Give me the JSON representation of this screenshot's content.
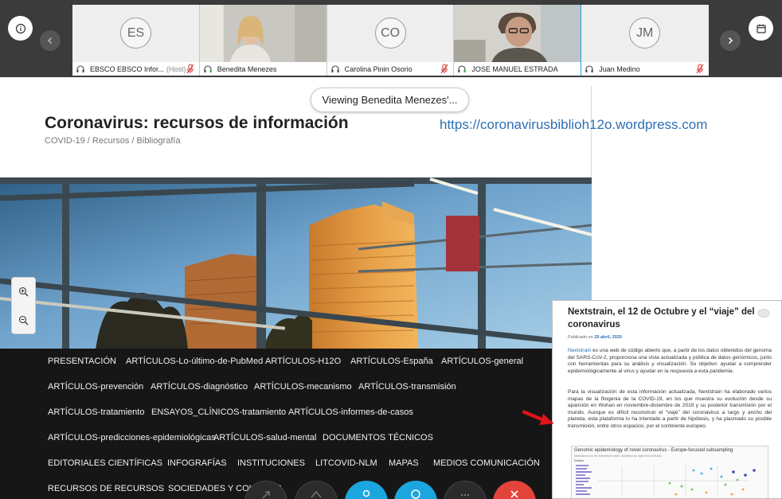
{
  "participants": [
    {
      "initials": "ES",
      "name": "EBSCO EBSCO Infor...",
      "host_tag": "(Host)",
      "video": false,
      "muted": true
    },
    {
      "initials": "",
      "name": "Benedita Menezes",
      "host_tag": "",
      "video": true,
      "muted": false
    },
    {
      "initials": "CO",
      "name": "Carolina Pinin Osorio",
      "host_tag": "",
      "video": false,
      "muted": true
    },
    {
      "initials": "",
      "name": "JOSE MANUEL ESTRADA",
      "host_tag": "",
      "video": true,
      "muted": false
    },
    {
      "initials": "JM",
      "name": "Juan Medino",
      "host_tag": "",
      "video": false,
      "muted": true
    }
  ],
  "viewing_banner": "Viewing Benedita Menezes'...",
  "site": {
    "title": "Coronavirus: recursos de información",
    "breadcrumb": "COVID-19 / Recursos / Bibliografía",
    "url": "https://coronavirusbiblioh12o.wordpress.com"
  },
  "menu": [
    "PRESENTACIÓN",
    "ARTÍCULOS-Lo-último-de-PubMed",
    "ARTÍCULOS-H12O",
    "ARTÍCULOS-España",
    "ARTÍCULOS-general",
    "ARTÍCULOS-prevención",
    "ARTÍCULOS-diagnóstico",
    "ARTÍCULOS-mecanismo",
    "ARTÍCULOS-transmisión",
    "ARTÍCULOS-tratamiento",
    "ENSAYOS_CLÍNICOS-tratamiento",
    "ARTÍCULOS-informes-de-casos",
    "ARTÍCULOS-predicciones-epidemiológicas",
    "ARTÍCULOS-salud-mental",
    "DOCUMENTOS TÉCNICOS",
    "EDITORIALES CIENTÍFICAS",
    "INFOGRAFÍAS",
    "INSTITUCIONES",
    "LITCOVID-NLM",
    "MAPAS",
    "MEDIOS COMUNICACIÓN",
    "RECURSOS DE RECURSOS",
    "SOCIEDADES Y COLEGIOS"
  ],
  "article": {
    "title": "Nextstrain, el 12 de Octubre y el “viaje” del coronavirus",
    "published_label": "Publicado en",
    "published_date": "29 abril, 2020",
    "p1_link": "Nextstrain",
    "p1_rest": " es una web de código abierto que, a partir de los datos obtenidos del genoma del SARS-CoV-2, proporciona una vista actualizada y pública de datos genómicos, junto con herramientas para su análisis y visualización. Su objetivo: ayudar a comprender epidemiológicamente al virus y ayudar en la respuesta a esta pandemia.",
    "p2": "Para la visualización de esta información actualizada, Nextstrain ha elaborado varios mapas de la filogenia de la COVID-19, en los que muestra su evolución desde su aparición en Wuhan en noviembre-diciembre de 2019 y su posterior transmisión por el mundo. Aunque es difícil reconstruir el “viaje” del coronavirus a largo y ancho del planeta, esta plataforma lo ha intentado a partir de hipótesis, y ha plasmado su posible transmisión, entre otros espacios, por el continente europeo.",
    "embed_title": "Genomic epidemiology of novel coronavirus - Europe-focused subsampling",
    "embed_sub": "Maintained by the Nextstrain team. Enabled by data from GISAID.",
    "embed_division_label": "Division"
  },
  "colors": {
    "accent_tile": "#1ba6e0",
    "link": "#2e6fb5",
    "menu_bg": "#161616",
    "ctrl_blue": "#1ba6e0",
    "ctrl_red": "#e2433b"
  }
}
